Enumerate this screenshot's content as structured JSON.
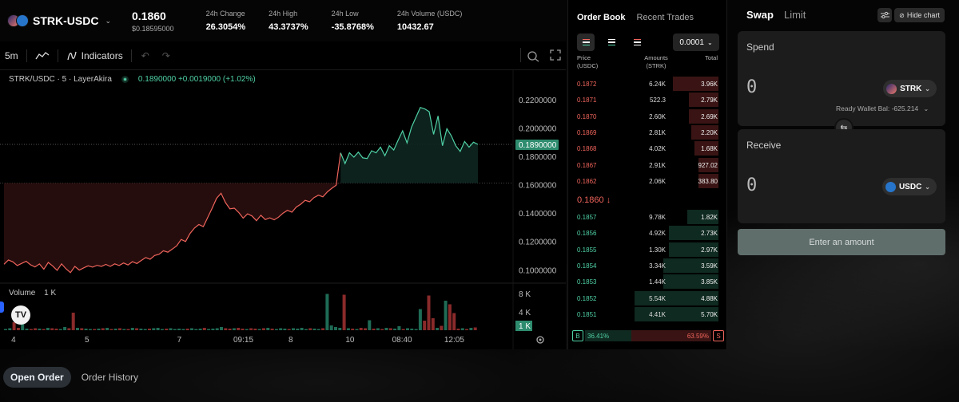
{
  "ticker": {
    "pair": "STRK-USDC",
    "price": "0.1860",
    "price_sub": "$0.18595000",
    "stats": [
      {
        "label": "24h Change",
        "value": "26.3054%"
      },
      {
        "label": "24h High",
        "value": "43.3737%"
      },
      {
        "label": "24h Low",
        "value": "-35.8768%"
      },
      {
        "label": "24h Volume (USDC)",
        "value": "10432.67"
      }
    ]
  },
  "chart": {
    "interval": "5m",
    "indicators_label": "Indicators",
    "legend_symbol": "STRK/USDC · 5 · LayerAkira",
    "legend_ohlc": "0.1890000  +0.0019000 (+1.02%)",
    "volume_label": "Volume",
    "volume_value": "1 K",
    "logo_text": "TV",
    "colors": {
      "up": "#4fd1a5",
      "down": "#f0645c",
      "up_fill": "#0e2620",
      "down_fill": "#2a0e0e"
    }
  },
  "chart_data": {
    "type": "area",
    "title": "",
    "price_axis": [
      "0.2200000",
      "0.2000000",
      "0.1800000",
      "0.1600000",
      "0.1400000",
      "0.1200000",
      "0.1000000"
    ],
    "current_price_label": "0.1890000",
    "volume_axis": [
      "8 K",
      "4 K"
    ],
    "current_volume_label": "1 K",
    "time_axis": [
      "4",
      "5",
      "7",
      "09:15",
      "8",
      "10",
      "08:40",
      "12:05"
    ],
    "ylim": [
      0.085,
      0.23
    ],
    "baseline": 0.1617,
    "series": [
      {
        "values": [
          0.1045,
          0.1075,
          0.1062,
          0.1036,
          0.1051,
          0.1066,
          0.1041,
          0.1026,
          0.1047,
          0.101,
          0.1058,
          0.1032,
          0.1002,
          0.1048,
          0.1013,
          0.0986,
          0.103,
          0.1004,
          0.102,
          0.1034,
          0.1025,
          0.1037,
          0.103,
          0.1044,
          0.103,
          0.1048,
          0.1036,
          0.1054,
          0.104,
          0.1063,
          0.105,
          0.1072,
          0.1092,
          0.108,
          0.1107,
          0.1115,
          0.114,
          0.113,
          0.1152,
          0.1175,
          0.122,
          0.1205,
          0.1262,
          0.13,
          0.1325,
          0.131,
          0.1375,
          0.144,
          0.151,
          0.1545,
          0.148,
          0.1435,
          0.144,
          0.141,
          0.137,
          0.14,
          0.1385,
          0.1352,
          0.139,
          0.136,
          0.1372,
          0.1358,
          0.1377,
          0.1405,
          0.1425,
          0.1412,
          0.1448,
          0.1468,
          0.1495,
          0.1485,
          0.1515,
          0.1532,
          0.152,
          0.1555,
          0.158,
          0.1602,
          0.183,
          0.1755,
          0.183,
          0.18,
          0.1835,
          0.1795,
          0.179,
          0.1845,
          0.183,
          0.187,
          0.181,
          0.188,
          0.185,
          0.192,
          0.1985,
          0.19,
          0.201,
          0.208,
          0.215,
          0.214,
          0.212,
          0.196,
          0.209,
          0.188,
          0.2,
          0.195,
          0.188,
          0.184,
          0.191,
          0.187,
          0.1905,
          0.189
        ]
      }
    ],
    "volume_max": 10,
    "volume": [
      0.3,
      0.5,
      2.0,
      0.6,
      1.5,
      0.4,
      0.3,
      0.5,
      0.4,
      0.3,
      0.6,
      0.5,
      0.4,
      0.3,
      0.8,
      0.5,
      4.4,
      0.6,
      0.5,
      0.4,
      0.3,
      0.3,
      0.4,
      0.5,
      0.6,
      0.3,
      0.4,
      0.5,
      0.3,
      0.3,
      0.6,
      0.5,
      0.4,
      0.3,
      0.4,
      0.5,
      0.6,
      0.3,
      0.4,
      0.5,
      0.3,
      0.4,
      0.3,
      0.4,
      0.5,
      0.3,
      0.4,
      0.6,
      0.3,
      0.4,
      0.5,
      0.8,
      0.5,
      0.4,
      0.5,
      0.6,
      0.4,
      0.3,
      0.5,
      0.4,
      0.3,
      0.5,
      0.6,
      0.4,
      0.3,
      0.5,
      0.4,
      0.3,
      0.5,
      0.4,
      0.6,
      0.3,
      0.5,
      0.4,
      0.3,
      0.5,
      9.1,
      1.2,
      0.8,
      0.6,
      8.9,
      0.5,
      0.4,
      0.3,
      0.6,
      0.5,
      2.5,
      0.4,
      0.5,
      0.3,
      0.6,
      0.5,
      0.4,
      1.0,
      0.3,
      0.5,
      0.4,
      0.3,
      5.3,
      2.4,
      8.7,
      3.0,
      0.6,
      1.1,
      7.4,
      6.5,
      4.3,
      0.4,
      0.5,
      0.3,
      0.6,
      0.7
    ]
  },
  "orderbook": {
    "tabs": [
      "Order Book",
      "Recent Trades"
    ],
    "tick_size": "0.0001",
    "headers": {
      "price": "Price\n(USDC)",
      "amount": "Amounts\n(STRK)",
      "total": "Total"
    },
    "asks": [
      {
        "price": "0.1872",
        "amount": "6.24K",
        "total": "3.96K",
        "depth": 0.32
      },
      {
        "price": "0.1871",
        "amount": "522.3",
        "total": "2.79K",
        "depth": 0.21
      },
      {
        "price": "0.1870",
        "amount": "2.60K",
        "total": "2.69K",
        "depth": 0.21
      },
      {
        "price": "0.1869",
        "amount": "2.81K",
        "total": "2.20K",
        "depth": 0.19
      },
      {
        "price": "0.1868",
        "amount": "4.02K",
        "total": "1.68K",
        "depth": 0.17
      },
      {
        "price": "0.1867",
        "amount": "2.91K",
        "total": "927.02",
        "depth": 0.14
      },
      {
        "price": "0.1862",
        "amount": "2.06K",
        "total": "383.80",
        "depth": 0.14
      }
    ],
    "mid_price": "0.1860 ↓",
    "bids": [
      {
        "price": "0.1857",
        "amount": "9.78K",
        "total": "1.82K",
        "depth": 0.22
      },
      {
        "price": "0.1856",
        "amount": "4.92K",
        "total": "2.73K",
        "depth": 0.35
      },
      {
        "price": "0.1855",
        "amount": "1.30K",
        "total": "2.97K",
        "depth": 0.35
      },
      {
        "price": "0.1854",
        "amount": "3.34K",
        "total": "3.59K",
        "depth": 0.39
      },
      {
        "price": "0.1853",
        "amount": "1.44K",
        "total": "3.85K",
        "depth": 0.39
      },
      {
        "price": "0.1852",
        "amount": "5.54K",
        "total": "4.88K",
        "depth": 0.59
      },
      {
        "price": "0.1851",
        "amount": "4.41K",
        "total": "5.70K",
        "depth": 0.59
      }
    ],
    "buy_label": "B",
    "sell_label": "S",
    "buy_pct": "36.41%",
    "sell_pct": "63.59%",
    "buy_ratio": 0.3641
  },
  "swap": {
    "tabs": [
      "Swap",
      "Limit"
    ],
    "hide_chart": "Hide chart",
    "spend_label": "Spend",
    "spend_amount": "0",
    "spend_token": "STRK",
    "wallet_balance": "Ready Wallet Bal: -625.214",
    "receive_label": "Receive",
    "receive_amount": "0",
    "receive_token": "USDC",
    "submit_label": "Enter an amount"
  },
  "bottom_tabs": [
    "Open Order",
    "Order History"
  ]
}
